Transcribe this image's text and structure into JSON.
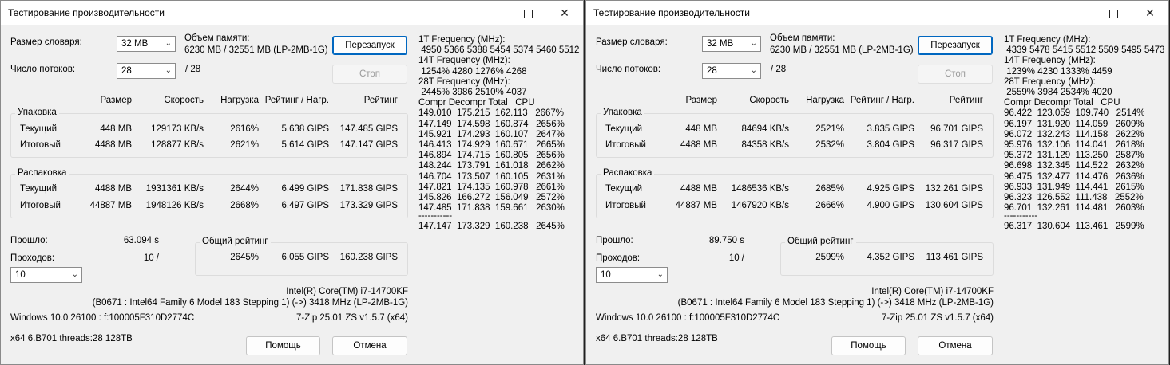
{
  "common": {
    "title": "Тестирование производительности",
    "dict_label": "Размер словаря:",
    "dict_value": "32 MB",
    "threads_label": "Число потоков:",
    "threads_value": "28",
    "threads_max": "/ 28",
    "memory_label": "Объем памяти:",
    "memory_value": "6230 MB / 32551 MB (LP-2MB-1G)",
    "restart_button": "Перезапуск",
    "stop_button": "Стоп",
    "col_size": "Размер",
    "col_speed": "Скорость",
    "col_load": "Нагрузка",
    "col_rating_per_load": "Рейтинг / Нагр.",
    "col_rating": "Рейтинг",
    "compress_group": "Упаковка",
    "decompress_group": "Распаковка",
    "row_current": "Текущий",
    "row_total": "Итоговый",
    "elapsed_label": "Прошло:",
    "passes_label": "Проходов:",
    "passes_select": "10",
    "overall_group": "Общий рейтинг",
    "cpu_name": "Intel(R) Core(TM) i7-14700KF",
    "cpu_details": "(B0671 : Intel64 Family 6 Model 183 Stepping 1) (->) 3418 MHz (LP-2MB-1G)",
    "os_info": "Windows 10.0 26100 : f:100005F310D2774C",
    "version": "7-Zip 25.01 ZS v1.5.7 (x64)",
    "arch": "x64 6.B701 threads:28 128TB",
    "help_button": "Помощь",
    "cancel_button": "Отмена",
    "separator": "-----------"
  },
  "windows": [
    {
      "compress_current": {
        "size": "448 MB",
        "speed": "129173 KB/s",
        "load": "2616%",
        "rpu": "5.638 GIPS",
        "rating": "147.485 GIPS"
      },
      "compress_total": {
        "size": "4488 MB",
        "speed": "128877 KB/s",
        "load": "2621%",
        "rpu": "5.614 GIPS",
        "rating": "147.147 GIPS"
      },
      "decompress_current": {
        "size": "4488 MB",
        "speed": "1931361 KB/s",
        "load": "2644%",
        "rpu": "6.499 GIPS",
        "rating": "171.838 GIPS"
      },
      "decompress_total": {
        "size": "44887 MB",
        "speed": "1948126 KB/s",
        "load": "2668%",
        "rpu": "6.497 GIPS",
        "rating": "173.329 GIPS"
      },
      "elapsed": "63.094 s",
      "passes": "10 /",
      "overall": {
        "load": "2645%",
        "rpu": "6.055 GIPS",
        "rating": "160.238 GIPS"
      },
      "log": [
        "1T Frequency (MHz):",
        " 4950 5366 5388 5454 5374 5460 5512",
        "14T Frequency (MHz):",
        " 1254% 4280 1276% 4268",
        "28T Frequency (MHz):",
        " 2445% 3986 2510% 4037",
        "Compr Decompr Total   CPU",
        "149.010  175.215  162.113   2667%",
        "147.149  174.598  160.874   2656%",
        "145.921  174.293  160.107   2647%",
        "146.413  174.929  160.671   2665%",
        "146.894  174.715  160.805   2656%",
        "148.244  173.791  161.018   2662%",
        "146.704  173.507  160.105   2631%",
        "147.821  174.135  160.978   2661%",
        "145.826  166.272  156.049   2572%",
        "147.485  171.838  159.661   2630%"
      ],
      "log_total": "147.147  173.329  160.238   2645%"
    },
    {
      "compress_current": {
        "size": "448 MB",
        "speed": "84694 KB/s",
        "load": "2521%",
        "rpu": "3.835 GIPS",
        "rating": "96.701 GIPS"
      },
      "compress_total": {
        "size": "4488 MB",
        "speed": "84358 KB/s",
        "load": "2532%",
        "rpu": "3.804 GIPS",
        "rating": "96.317 GIPS"
      },
      "decompress_current": {
        "size": "4488 MB",
        "speed": "1486536 KB/s",
        "load": "2685%",
        "rpu": "4.925 GIPS",
        "rating": "132.261 GIPS"
      },
      "decompress_total": {
        "size": "44887 MB",
        "speed": "1467920 KB/s",
        "load": "2666%",
        "rpu": "4.900 GIPS",
        "rating": "130.604 GIPS"
      },
      "elapsed": "89.750 s",
      "passes": "10 /",
      "overall": {
        "load": "2599%",
        "rpu": "4.352 GIPS",
        "rating": "113.461 GIPS"
      },
      "log": [
        "1T Frequency (MHz):",
        " 4339 5478 5415 5512 5509 5495 5473",
        "14T Frequency (MHz):",
        " 1239% 4230 1333% 4459",
        "28T Frequency (MHz):",
        " 2559% 3984 2534% 4020",
        "Compr Decompr Total   CPU",
        "96.422  123.059  109.740   2514%",
        "96.197  131.920  114.059   2609%",
        "96.072  132.243  114.158   2622%",
        "95.976  132.106  114.041   2618%",
        "95.372  131.129  113.250   2587%",
        "96.698  132.345  114.522   2632%",
        "96.475  132.477  114.476   2636%",
        "96.933  131.949  114.441   2615%",
        "96.323  126.552  111.438   2552%",
        "96.701  132.261  114.481   2603%"
      ],
      "log_total": "96.317  130.604  113.461   2599%"
    }
  ]
}
